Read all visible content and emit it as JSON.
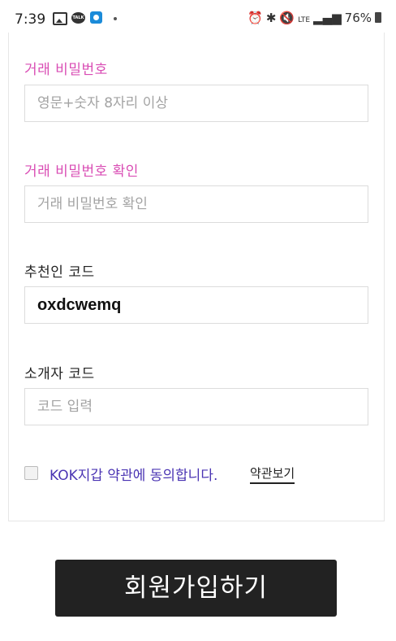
{
  "status_bar": {
    "time": "7:39",
    "network": "LTE",
    "battery": "76%"
  },
  "form": {
    "trade_password": {
      "label": "거래 비밀번호",
      "placeholder": "영문+숫자 8자리 이상"
    },
    "trade_password_confirm": {
      "label": "거래 비밀번호 확인",
      "placeholder": "거래 비밀번호 확인"
    },
    "referral_code": {
      "label": "추천인 코드",
      "value": "oxdcwemq"
    },
    "introducer_code": {
      "label": "소개자 코드",
      "placeholder": "코드 입력"
    },
    "agreement": {
      "text": "KOK지갑 약관에 동의합니다.",
      "link": "약관보기",
      "checked": false
    }
  },
  "submit_label": "회원가입하기",
  "colors": {
    "label_accent": "#d94cb4",
    "agreement_text": "#4a34b3",
    "button_bg": "#222222"
  }
}
